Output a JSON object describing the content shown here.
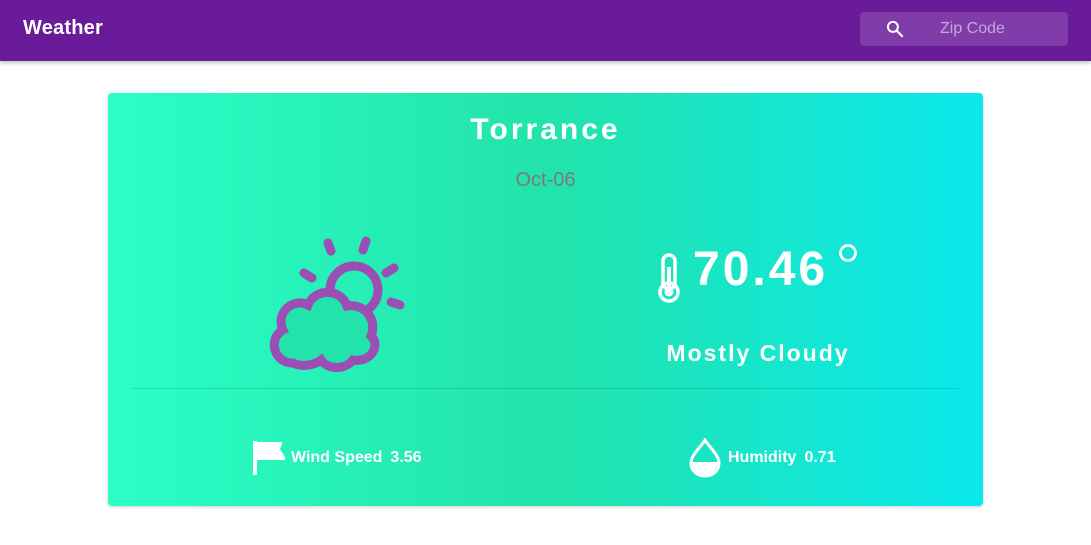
{
  "app": {
    "title": "Weather"
  },
  "search": {
    "placeholder": "Zip Code",
    "value": "",
    "icon": "search-icon"
  },
  "weather": {
    "city": "Torrance",
    "date": "Oct-06",
    "temperature": "70.46",
    "condition": "Mostly Cloudy",
    "icon": "partly-cloudy-icon",
    "wind_label": "Wind Speed",
    "wind_value": "3.56",
    "humidity_label": "Humidity",
    "humidity_value": "0.71"
  },
  "colors": {
    "appbar": "#6a1b9a",
    "gradient_start": "#2affc6",
    "gradient_mid": "#22e3aa",
    "gradient_end": "#0ae8ec",
    "icon_purple": "#9b4fb4",
    "date_text": "#7a7a7a"
  }
}
